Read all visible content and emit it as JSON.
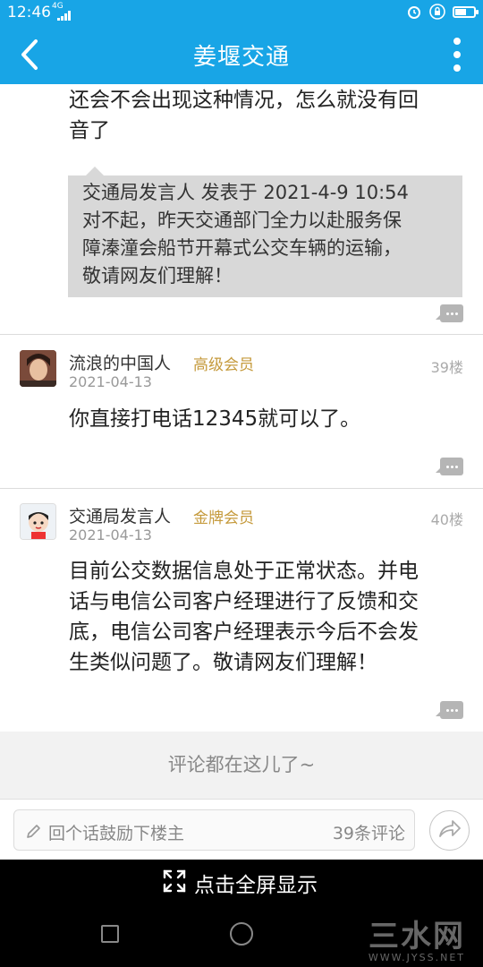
{
  "status_bar": {
    "time": "12:46",
    "network": "4G",
    "battery_level": 0.6
  },
  "nav": {
    "title": "姜堰交通",
    "back_icon": "chevron-left-icon",
    "more_icon": "more-vertical-icon"
  },
  "top_post": {
    "text_line1": "还会不会出现这种情况，怎么就没有回",
    "text_line2": "音了",
    "quote": {
      "header": "交通局发言人 发表于 2021-4-9 10:54",
      "line1": "对不起，昨天交通部门全力以赴服务保",
      "line2": "障溱潼会船节开幕式公交车辆的运输，",
      "line3": "敬请网友们理解！"
    }
  },
  "posts": [
    {
      "username": "流浪的中国人",
      "badge": "高级会员",
      "date": "2021-04-13",
      "floor": "39楼",
      "lines": [
        "你直接打电话12345就可以了。"
      ]
    },
    {
      "username": "交通局发言人",
      "badge": "金牌会员",
      "date": "2021-04-13",
      "floor": "40楼",
      "lines": [
        "目前公交数据信息处于正常状态。并电",
        "话与电信公司客户经理进行了反馈和交",
        "底，电信公司客户经理表示今后不会发",
        "生类似问题了。敬请网友们理解！"
      ]
    }
  ],
  "comments_banner": "评论都在这儿了~",
  "comment_bar": {
    "placeholder": "回个话鼓励下楼主",
    "count": "39条评论"
  },
  "fullscreen": {
    "label": "点击全屏显示"
  },
  "watermark": {
    "main": "三水网",
    "sub": "WWW.JYSS.NET"
  },
  "colors": {
    "primary": "#18a5e6",
    "badge": "#c59a3c"
  }
}
